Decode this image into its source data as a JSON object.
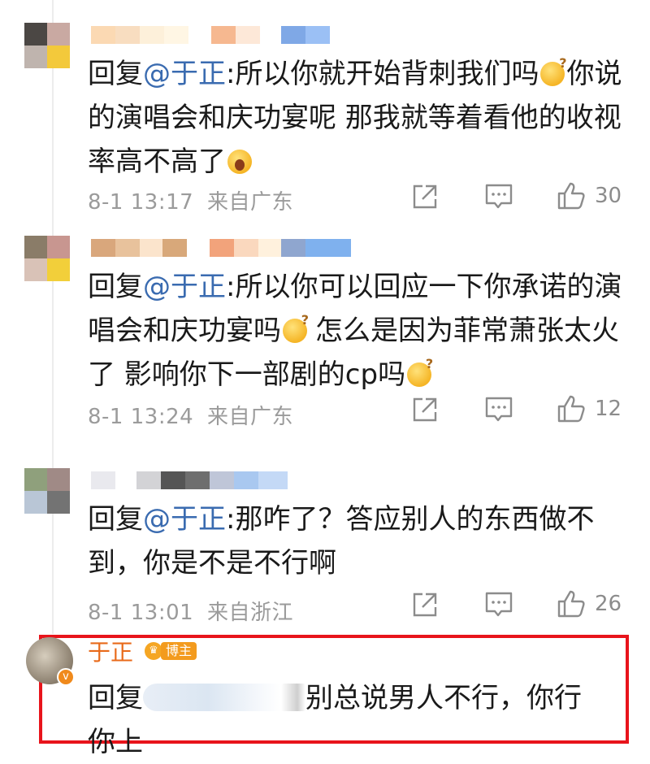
{
  "comments": [
    {
      "reply_prefix": "回复",
      "mention": "@于正",
      "colon": ":",
      "text_1": "所以你就开始背刺我们吗",
      "text_2": "你说的演唱会和庆功宴呢 那我就等着看他的收视率高不高了",
      "time": "8-1 13:17",
      "location": "来自广东",
      "likes": "30",
      "avatar_colors": [
        "#4b4744",
        "#c9a9a2",
        "#bfb4ae",
        "#f3c93b"
      ],
      "name_colors": [
        "#fbd9b3",
        "#f8ddc0",
        "#fdf0da",
        "#fff6e4",
        "#ffffff",
        "#f6b890",
        "#fde8d8",
        "#ffffff",
        "#7fa8e6",
        "#9bc0f5"
      ]
    },
    {
      "reply_prefix": "回复",
      "mention": "@于正",
      "colon": ":",
      "text_1": "所以你可以回应一下你承诺的演唱会和庆功宴吗",
      "text_2": "怎么是因为菲常萧张太火了 影响你下一部剧的cp吗",
      "time": "8-1 13:24",
      "location": "来自广东",
      "likes": "12",
      "avatar_colors": [
        "#8a7c68",
        "#c89690",
        "#d9c2b7",
        "#f2cf3a"
      ],
      "name_colors": [
        "#d9a77c",
        "#e8c29c",
        "#fbe4cc",
        "#d8a87a",
        "#ffffff",
        "#f2a37b",
        "#fad8be",
        "#fff1dd",
        "#8fa6cf",
        "#7fb1ee"
      ]
    },
    {
      "reply_prefix": "回复",
      "mention": "@于正",
      "colon": ":",
      "text_1": "那咋了？答应别人的东西做不到，你是不是不行啊",
      "time": "8-1 13:01",
      "location": "来自浙江",
      "likes": "26",
      "avatar_colors": [
        "#8fa07c",
        "#a08a86",
        "#b9c6d6",
        "#737373"
      ],
      "name_colors": [
        "#e9e9ee",
        "#ffffff",
        "#d3d3d6",
        "#555555",
        "#6e6e6e",
        "#bfc6d8",
        "#a9c8f0",
        "#c4d9f6"
      ]
    }
  ],
  "author_reply": {
    "name": "于正",
    "badge": "博主",
    "reply_prefix": "回复",
    "text": "别总说男人不行，你行你上"
  },
  "icons": [
    "share-icon",
    "comment-icon",
    "like-icon"
  ],
  "colors": {
    "mention": "#3a6bb0",
    "highlight": "#e8141b",
    "author_name": "#e86a1a",
    "meta": "#9b9b9b"
  }
}
